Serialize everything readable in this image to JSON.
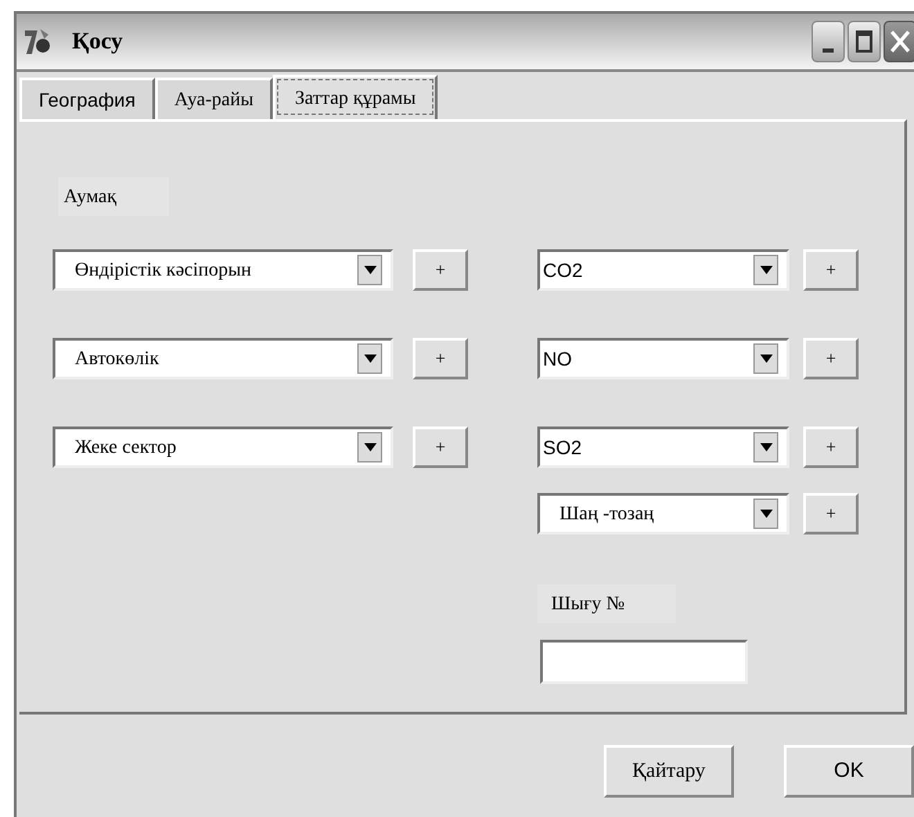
{
  "window": {
    "title": "Қосу"
  },
  "tabs": [
    {
      "label": "География",
      "selected": false
    },
    {
      "label": "Ауа-райы",
      "selected": false
    },
    {
      "label": "Заттар құрамы",
      "selected": true
    }
  ],
  "region_label": "Аумақ",
  "sources": [
    {
      "value": "Өндірістік кәсіпорын",
      "add": "+"
    },
    {
      "value": "Автокөлік",
      "add": "+"
    },
    {
      "value": "Жеке сектор",
      "add": "+"
    }
  ],
  "substances": [
    {
      "value": "CO2",
      "add": "+"
    },
    {
      "value": "NO",
      "add": "+"
    },
    {
      "value": "SO2",
      "add": "+"
    },
    {
      "value": "Шаң -тозаң",
      "add": "+"
    }
  ],
  "output": {
    "label": "Шығу №"
  },
  "buttons": [
    "Қайтару",
    "OK"
  ]
}
